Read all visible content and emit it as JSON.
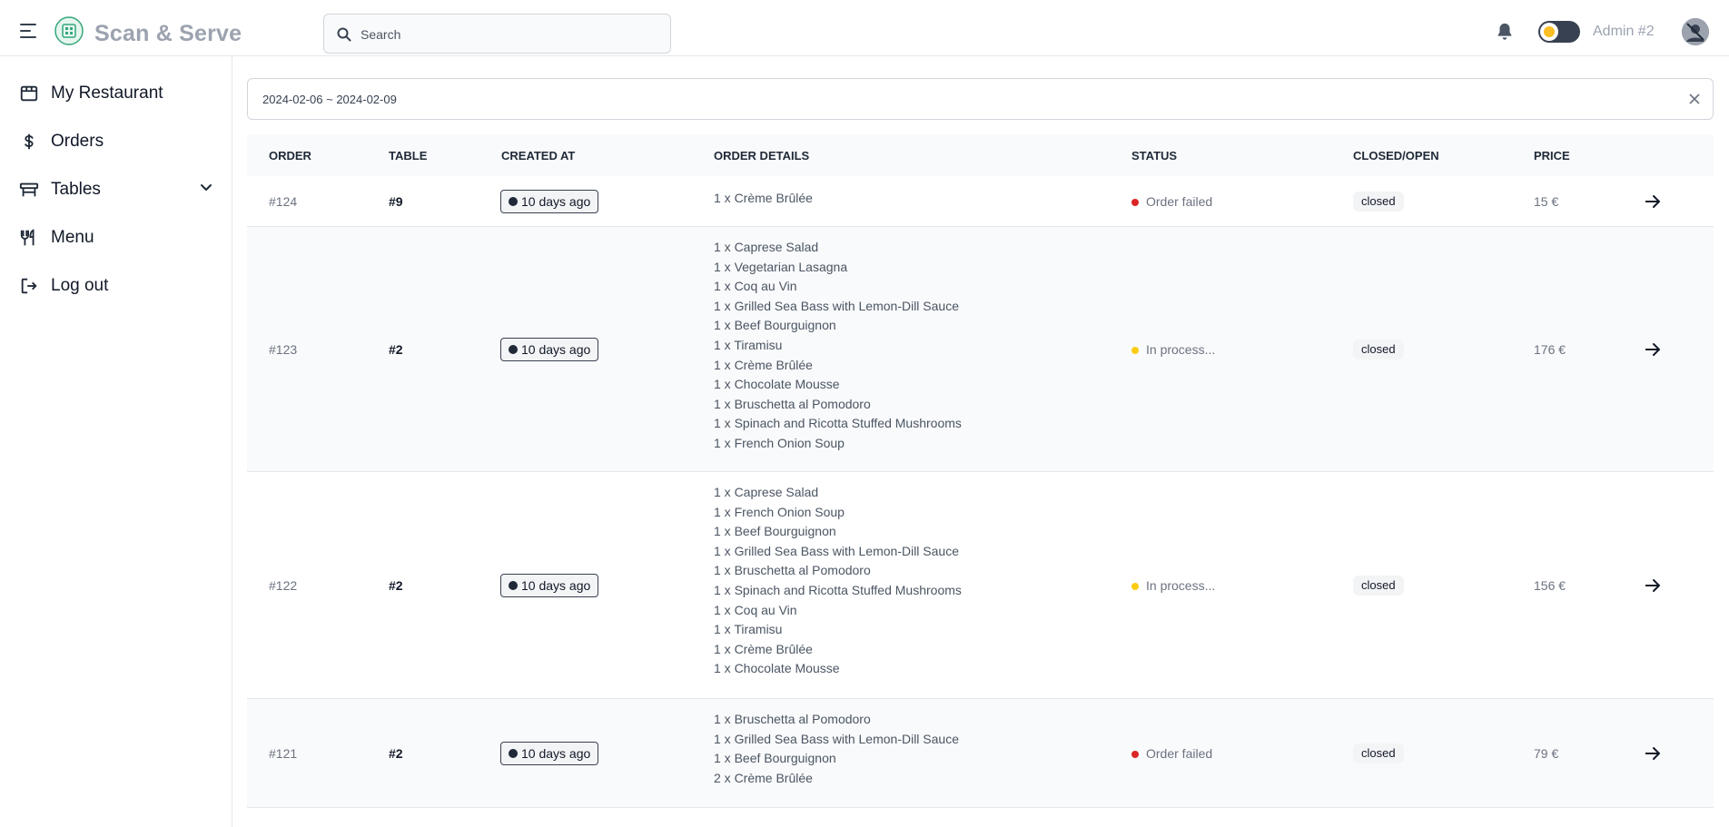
{
  "header": {
    "brand": "Scan & Serve",
    "search_placeholder": "Search",
    "admin_label": "Admin #2"
  },
  "sidebar": {
    "items": [
      {
        "label": "My Restaurant",
        "icon": "store-icon"
      },
      {
        "label": "Orders",
        "icon": "dollar-icon"
      },
      {
        "label": "Tables",
        "icon": "table-icon"
      },
      {
        "label": "Menu",
        "icon": "utensils-icon"
      },
      {
        "label": "Log out",
        "icon": "logout-icon"
      }
    ]
  },
  "filter": {
    "date_range": "2024-02-06 ~ 2024-02-09"
  },
  "table": {
    "headers": {
      "order": "ORDER",
      "table": "TABLE",
      "created_at": "CREATED AT",
      "order_details": "ORDER DETAILS",
      "status": "STATUS",
      "closed_open": "CLOSED/OPEN",
      "price": "PRICE"
    },
    "rows": [
      {
        "order": "#124",
        "table": "#9",
        "created": "10 days ago",
        "details": [
          "1 x Crème Brûlée"
        ],
        "status": "Order failed",
        "status_color": "#dc2626",
        "closed": "closed",
        "price": "15 €"
      },
      {
        "order": "#123",
        "table": "#2",
        "created": "10 days ago",
        "details": [
          "1 x Caprese Salad",
          "1 x Vegetarian Lasagna",
          "1 x Coq au Vin",
          "1 x Grilled Sea Bass with Lemon-Dill Sauce",
          "1 x Beef Bourguignon",
          "1 x Tiramisu",
          "1 x Crème Brûlée",
          "1 x Chocolate Mousse",
          "1 x Bruschetta al Pomodoro",
          "1 x Spinach and Ricotta Stuffed Mushrooms",
          "1 x French Onion Soup"
        ],
        "status": "In process...",
        "status_color": "#facc15",
        "closed": "closed",
        "price": "176 €"
      },
      {
        "order": "#122",
        "table": "#2",
        "created": "10 days ago",
        "details": [
          "1 x Caprese Salad",
          "1 x French Onion Soup",
          "1 x Beef Bourguignon",
          "1 x Grilled Sea Bass with Lemon-Dill Sauce",
          "1 x Bruschetta al Pomodoro",
          "1 x Spinach and Ricotta Stuffed Mushrooms",
          "1 x Coq au Vin",
          "1 x Tiramisu",
          "1 x Crème Brûlée",
          "1 x Chocolate Mousse"
        ],
        "status": "In process...",
        "status_color": "#facc15",
        "closed": "closed",
        "price": "156 €"
      },
      {
        "order": "#121",
        "table": "#2",
        "created": "10 days ago",
        "details": [
          "1 x Bruschetta al Pomodoro",
          "1 x Grilled Sea Bass with Lemon-Dill Sauce",
          "1 x Beef Bourguignon",
          "2 x Crème Brûlée"
        ],
        "status": "Order failed",
        "status_color": "#dc2626",
        "closed": "closed",
        "price": "79 €"
      }
    ]
  }
}
